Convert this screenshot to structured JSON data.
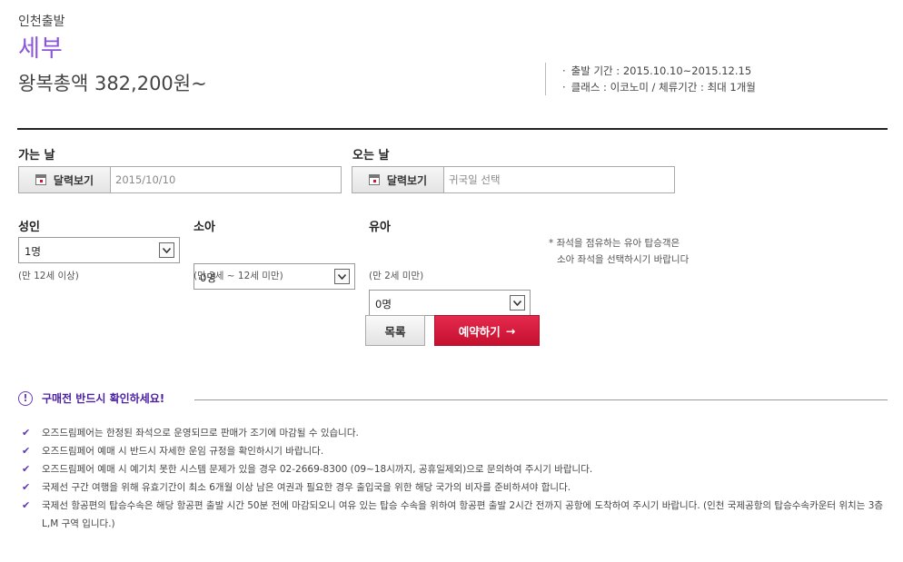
{
  "header": {
    "origin": "인천출발",
    "destination": "세부",
    "price": "왕복총액 382,200원~",
    "info": [
      "출발 기간 : 2015.10.10~2015.12.15",
      "클래스 : 이코노미 / 체류기간 : 최대 1개월"
    ]
  },
  "dates": {
    "depart_label": "가는 날",
    "return_label": "오는 날",
    "calendar_button": "달력보기",
    "depart_value": "2015/10/10",
    "return_placeholder": "귀국일 선택"
  },
  "passengers": {
    "adult": {
      "label": "성인",
      "value": "1명",
      "note": "(만 12세 이상)"
    },
    "child": {
      "label": "소아",
      "value": "0명",
      "note": "(만 2세 ~ 12세 미만)"
    },
    "infant": {
      "label": "유아",
      "value": "0명",
      "note": "(만 2세 미만)"
    },
    "remark": [
      "* 좌석을 점유하는 유아 탑승객은",
      "소아 좌석을 선택하시기 바랍니다"
    ]
  },
  "actions": {
    "list": "목록",
    "book": "예약하기"
  },
  "notice": {
    "title": "구매전 반드시 확인하세요!",
    "items": [
      "오즈드림페어는 한정된 좌석으로 운영되므로 판매가 조기에 마감될 수 있습니다.",
      "오즈드림페어 예매 시 반드시 자세한 운임 규정을 확인하시기 바랍니다.",
      "오즈드림페어 예매 시 예기치 못한 시스템 문제가 있을 경우 02-2669-8300 (09~18시까지, 공휴일제외)으로 문의하여 주시기 바랍니다.",
      "국제선 구간 여행을 위해 유효기간이 최소 6개월 이상 남은 여권과 필요한 경우 출입국을 위한 해당 국가의 비자를 준비하셔야 합니다.",
      "국제선 항공편의 탑승수속은 해당 항공편 출발 시간 50분 전에 마감되오니 여유 있는 탑승 수속을 위하여 항공편 출발 2시간 전까지 공항에 도착하여 주시기 바랍니다. (인천 국제공항의 탑승수속카운터 위치는 3층 L,M 구역 입니다.)"
    ]
  },
  "colors": {
    "accent": "#8a55d9",
    "notice": "#4a1fa0",
    "book_button": "#d4123a"
  }
}
